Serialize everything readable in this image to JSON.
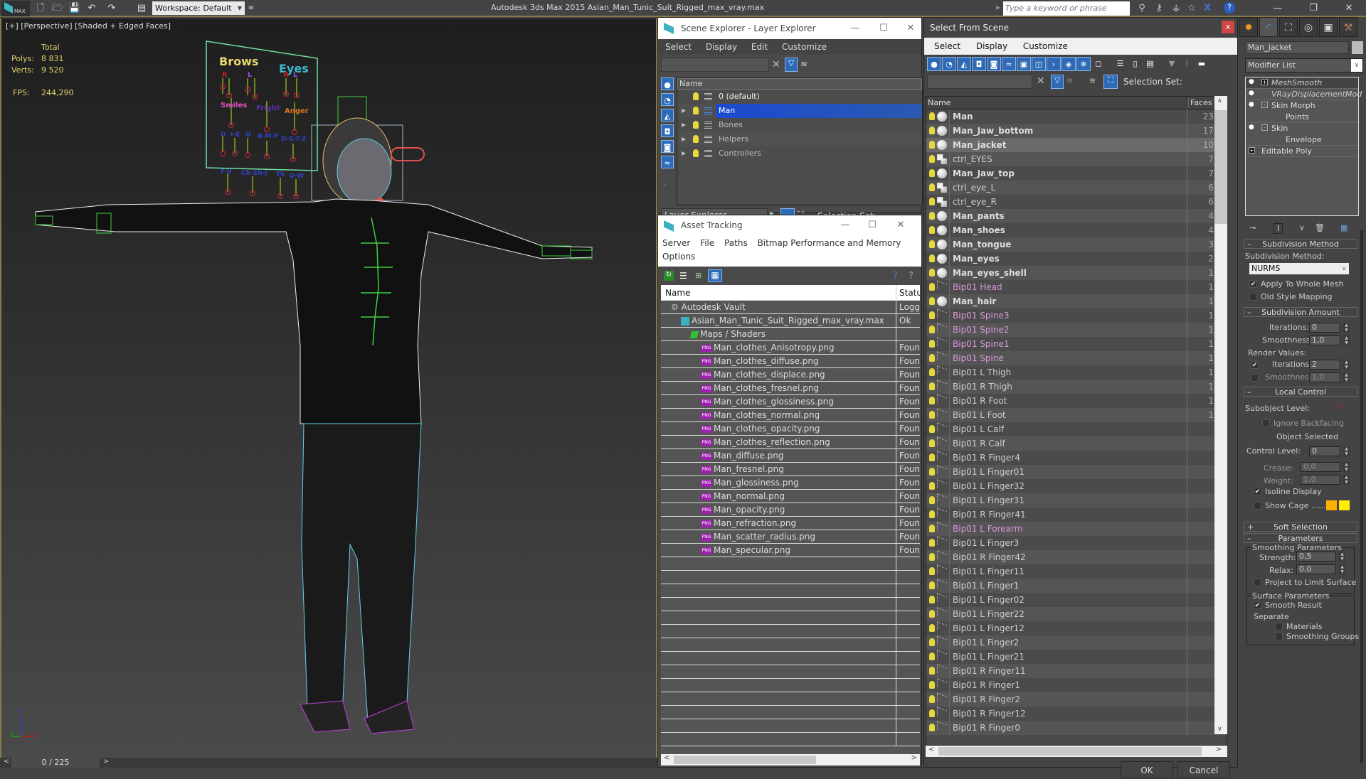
{
  "app": {
    "title": "Autodesk 3ds Max  2015    Asian_Man_Tunic_Suit_Rigged_max_vray.max",
    "logo_text": "MAX",
    "workspace": "Workspace: Default",
    "search_placeholder": "Type a keyword or phrase"
  },
  "viewport": {
    "label": "[+] [Perspective] [Shaded + Edged Faces]",
    "stats": {
      "header": "Total",
      "polys_label": "Polys:",
      "polys": "8 831",
      "verts_label": "Verts:",
      "verts": "9 520",
      "fps_label": "FPS:",
      "fps": "244,290"
    },
    "face_controls": {
      "brows": "Brows",
      "eyes": "Eyes",
      "r": "R",
      "l": "L",
      "smiles": "Smiles",
      "fright": "Fright",
      "anger": "Anger",
      "visemes_row1": [
        "O",
        "I-E",
        "U",
        "B-M-P",
        "D-S-T-Z"
      ],
      "visemes_row2": [
        "F-V",
        "Ch-Sh-J",
        "Th",
        "Q-W"
      ]
    },
    "axis": {
      "x": "x",
      "y": "y",
      "z": "z"
    }
  },
  "timeline": {
    "prev": "<",
    "value": "0 / 225",
    "next": ">"
  },
  "scene_explorer": {
    "title": "Scene Explorer - Layer Explorer",
    "menu": [
      "Select",
      "Display",
      "Edit",
      "Customize"
    ],
    "column": "Name",
    "layers": [
      {
        "name": "0 (default)",
        "expandable": false,
        "selected": false
      },
      {
        "name": "Man",
        "expandable": true,
        "selected": true
      },
      {
        "name": "Bones",
        "expandable": true,
        "selected": false
      },
      {
        "name": "Helpers",
        "expandable": true,
        "selected": false
      },
      {
        "name": "Controllers",
        "expandable": true,
        "selected": false
      }
    ],
    "mode": "Layer Explorer",
    "selection_set_label": "Selection Set:"
  },
  "asset_tracking": {
    "title": "Asset Tracking",
    "menu": [
      "Server",
      "File",
      "Paths",
      "Bitmap Performance and Memory",
      "Options"
    ],
    "columns": [
      "Name",
      "Status"
    ],
    "rows": [
      {
        "name": "Autodesk Vault",
        "status": "Logged",
        "indent": 1,
        "icon": "vault"
      },
      {
        "name": "Asian_Man_Tunic_Suit_Rigged_max_vray.max",
        "status": "Ok",
        "indent": 2,
        "icon": "max"
      },
      {
        "name": "Maps / Shaders",
        "status": "",
        "indent": 3,
        "icon": "maps"
      },
      {
        "name": "Man_clothes_Anisotropy.png",
        "status": "Found",
        "indent": 4,
        "icon": "png"
      },
      {
        "name": "Man_clothes_diffuse.png",
        "status": "Found",
        "indent": 4,
        "icon": "png"
      },
      {
        "name": "Man_clothes_displace.png",
        "status": "Found",
        "indent": 4,
        "icon": "png"
      },
      {
        "name": "Man_clothes_fresnel.png",
        "status": "Found",
        "indent": 4,
        "icon": "png"
      },
      {
        "name": "Man_clothes_glossiness.png",
        "status": "Found",
        "indent": 4,
        "icon": "png"
      },
      {
        "name": "Man_clothes_normal.png",
        "status": "Found",
        "indent": 4,
        "icon": "png"
      },
      {
        "name": "Man_clothes_opacity.png",
        "status": "Found",
        "indent": 4,
        "icon": "png"
      },
      {
        "name": "Man_clothes_reflection.png",
        "status": "Found",
        "indent": 4,
        "icon": "png"
      },
      {
        "name": "Man_diffuse.png",
        "status": "Found",
        "indent": 4,
        "icon": "png"
      },
      {
        "name": "Man_fresnel.png",
        "status": "Found",
        "indent": 4,
        "icon": "png"
      },
      {
        "name": "Man_glossiness.png",
        "status": "Found",
        "indent": 4,
        "icon": "png"
      },
      {
        "name": "Man_normal.png",
        "status": "Found",
        "indent": 4,
        "icon": "png"
      },
      {
        "name": "Man_opacity.png",
        "status": "Found",
        "indent": 4,
        "icon": "png"
      },
      {
        "name": "Man_refraction.png",
        "status": "Found",
        "indent": 4,
        "icon": "png"
      },
      {
        "name": "Man_scatter_radius.png",
        "status": "Found",
        "indent": 4,
        "icon": "png"
      },
      {
        "name": "Man_specular.png",
        "status": "Found",
        "indent": 4,
        "icon": "png"
      }
    ],
    "png_badge": "PNG"
  },
  "select_from_scene": {
    "title": "Select From Scene",
    "close": "x",
    "menu": [
      "Select",
      "Display",
      "Customize"
    ],
    "selection_set_label": "Selection Set:",
    "columns": [
      "Name",
      "Faces"
    ],
    "rows": [
      {
        "name": "Man",
        "type": "mesh",
        "faces": "23",
        "bold": true,
        "selected": false
      },
      {
        "name": "Man_Jaw_bottom",
        "type": "mesh",
        "faces": "17",
        "bold": true,
        "selected": false
      },
      {
        "name": "Man_jacket",
        "type": "mesh",
        "faces": "10",
        "bold": true,
        "selected": true
      },
      {
        "name": "ctrl_EYES",
        "type": "shape",
        "faces": "7",
        "bold": false,
        "selected": false
      },
      {
        "name": "Man_Jaw_top",
        "type": "mesh",
        "faces": "7",
        "bold": true,
        "selected": false
      },
      {
        "name": "ctrl_eye_L",
        "type": "shape",
        "faces": "6",
        "bold": false,
        "selected": false
      },
      {
        "name": "ctrl_eye_R",
        "type": "shape",
        "faces": "6",
        "bold": false,
        "selected": false
      },
      {
        "name": "Man_pants",
        "type": "mesh",
        "faces": "4",
        "bold": true,
        "selected": false
      },
      {
        "name": "Man_shoes",
        "type": "mesh",
        "faces": "4",
        "bold": true,
        "selected": false
      },
      {
        "name": "Man_tongue",
        "type": "mesh",
        "faces": "3",
        "bold": true,
        "selected": false
      },
      {
        "name": "Man_eyes",
        "type": "mesh",
        "faces": "2",
        "bold": true,
        "selected": false
      },
      {
        "name": "Man_eyes_shell",
        "type": "mesh",
        "faces": "1",
        "bold": true,
        "selected": false
      },
      {
        "name": "Bip01 Head",
        "type": "bone-pink",
        "faces": "1",
        "bold": false,
        "selected": false
      },
      {
        "name": "Man_hair",
        "type": "mesh",
        "faces": "1",
        "bold": true,
        "selected": false
      },
      {
        "name": "Bip01 Spine3",
        "type": "bone-pink",
        "faces": "1",
        "bold": false,
        "selected": false
      },
      {
        "name": "Bip01 Spine2",
        "type": "bone-pink",
        "faces": "1",
        "bold": false,
        "selected": false
      },
      {
        "name": "Bip01 Spine1",
        "type": "bone-pink",
        "faces": "1",
        "bold": false,
        "selected": false
      },
      {
        "name": "Bip01 Spine",
        "type": "bone-pink",
        "faces": "1",
        "bold": false,
        "selected": false
      },
      {
        "name": "Bip01 L Thigh",
        "type": "bone",
        "faces": "1",
        "bold": false,
        "selected": false
      },
      {
        "name": "Bip01 R Thigh",
        "type": "bone",
        "faces": "1",
        "bold": false,
        "selected": false
      },
      {
        "name": "Bip01 R Foot",
        "type": "bone",
        "faces": "1",
        "bold": false,
        "selected": false
      },
      {
        "name": "Bip01 L Foot",
        "type": "bone",
        "faces": "1",
        "bold": false,
        "selected": false
      },
      {
        "name": "Bip01 L Calf",
        "type": "bone",
        "faces": "",
        "bold": false,
        "selected": false
      },
      {
        "name": "Bip01 R Calf",
        "type": "bone",
        "faces": "",
        "bold": false,
        "selected": false
      },
      {
        "name": "Bip01 R Finger4",
        "type": "bone",
        "faces": "",
        "bold": false,
        "selected": false
      },
      {
        "name": "Bip01 L Finger01",
        "type": "bone",
        "faces": "",
        "bold": false,
        "selected": false
      },
      {
        "name": "Bip01 L Finger32",
        "type": "bone",
        "faces": "",
        "bold": false,
        "selected": false
      },
      {
        "name": "Bip01 L Finger31",
        "type": "bone",
        "faces": "",
        "bold": false,
        "selected": false
      },
      {
        "name": "Bip01 R Finger41",
        "type": "bone",
        "faces": "",
        "bold": false,
        "selected": false
      },
      {
        "name": "Bip01 L Forearm",
        "type": "bone-pink",
        "faces": "",
        "bold": false,
        "selected": false
      },
      {
        "name": "Bip01 L Finger3",
        "type": "bone",
        "faces": "",
        "bold": false,
        "selected": false
      },
      {
        "name": "Bip01 R Finger42",
        "type": "bone",
        "faces": "",
        "bold": false,
        "selected": false
      },
      {
        "name": "Bip01 L Finger11",
        "type": "bone",
        "faces": "",
        "bold": false,
        "selected": false
      },
      {
        "name": "Bip01 L Finger1",
        "type": "bone",
        "faces": "",
        "bold": false,
        "selected": false
      },
      {
        "name": "Bip01 L Finger02",
        "type": "bone",
        "faces": "",
        "bold": false,
        "selected": false
      },
      {
        "name": "Bip01 L Finger22",
        "type": "bone",
        "faces": "",
        "bold": false,
        "selected": false
      },
      {
        "name": "Bip01 L Finger12",
        "type": "bone",
        "faces": "",
        "bold": false,
        "selected": false
      },
      {
        "name": "Bip01 L Finger2",
        "type": "bone",
        "faces": "",
        "bold": false,
        "selected": false
      },
      {
        "name": "Bip01 L Finger21",
        "type": "bone",
        "faces": "",
        "bold": false,
        "selected": false
      },
      {
        "name": "Bip01 R Finger11",
        "type": "bone",
        "faces": "",
        "bold": false,
        "selected": false
      },
      {
        "name": "Bip01 R Finger1",
        "type": "bone",
        "faces": "",
        "bold": false,
        "selected": false
      },
      {
        "name": "Bip01 R Finger2",
        "type": "bone",
        "faces": "",
        "bold": false,
        "selected": false
      },
      {
        "name": "Bip01 R Finger12",
        "type": "bone",
        "faces": "",
        "bold": false,
        "selected": false
      },
      {
        "name": "Bip01 R Finger0",
        "type": "bone",
        "faces": "",
        "bold": false,
        "selected": false
      }
    ],
    "ok": "OK",
    "cancel": "Cancel"
  },
  "command_panel": {
    "object_name": "Man_jacket",
    "modifier_list": "Modifier List",
    "stack": [
      {
        "name": "MeshSmooth",
        "italic": true,
        "toggle": "+",
        "bulb": true,
        "sub": null
      },
      {
        "name": "VRayDisplacementMod",
        "italic": true,
        "toggle": "",
        "bulb": true,
        "sub": null
      },
      {
        "name": "Skin Morph",
        "italic": false,
        "toggle": "-",
        "bulb": true,
        "sub": "Points"
      },
      {
        "name": "Skin",
        "italic": false,
        "toggle": "-",
        "bulb": true,
        "sub": "Envelope"
      },
      {
        "name": "Editable Poly",
        "italic": false,
        "toggle": "+",
        "bulb": false,
        "sub": null
      }
    ],
    "subdivision_method": {
      "title": "Subdivision Method",
      "label": "Subdivision Method:",
      "value": "NURMS",
      "apply_whole_mesh": {
        "label": "Apply To Whole Mesh",
        "checked": true
      },
      "old_style_mapping": {
        "label": "Old Style Mapping",
        "checked": false
      }
    },
    "subdivision_amount": {
      "title": "Subdivision Amount",
      "iterations_label": "Iterations:",
      "iterations": "0",
      "smoothness_label": "Smoothness:",
      "smoothness": "1,0",
      "render_values_label": "Render Values:",
      "render_iterations": {
        "checked": true,
        "label": "Iterations:",
        "value": "2"
      },
      "render_smoothness": {
        "checked": false,
        "label": "Smoothness:",
        "value": "1,0"
      }
    },
    "local_control": {
      "title": "Local Control",
      "subobject_label": "Subobject Level:",
      "ignore_backfacing": {
        "label": "Ignore Backfacing",
        "checked": false
      },
      "status": "Object Selected",
      "control_level_label": "Control Level:",
      "control_level": "0",
      "crease_label": "Crease:",
      "crease": "0,0",
      "weight_label": "Weight:",
      "weight": "1,0",
      "isoline_display": {
        "label": "Isoline Display",
        "checked": true
      },
      "show_cage": {
        "label": "Show Cage ......",
        "checked": false
      },
      "cage_colors": [
        "#ffb000",
        "#ffee00"
      ]
    },
    "soft_selection": {
      "title": "Soft Selection",
      "toggle": "+"
    },
    "parameters": {
      "title": "Parameters",
      "smoothing_group": "Smoothing Parameters",
      "strength_label": "Strength:",
      "strength": "0,5",
      "relax_label": "Relax:",
      "relax": "0,0",
      "project_limit": {
        "label": "Project to Limit Surface",
        "checked": false
      },
      "surface_group": "Surface Parameters",
      "smooth_result": {
        "label": "Smooth Result",
        "checked": true
      },
      "separate_label": "Separate",
      "materials": {
        "label": "Materials",
        "checked": false
      },
      "smoothing_groups": {
        "label": "Smoothing Groups",
        "checked": false
      }
    }
  }
}
